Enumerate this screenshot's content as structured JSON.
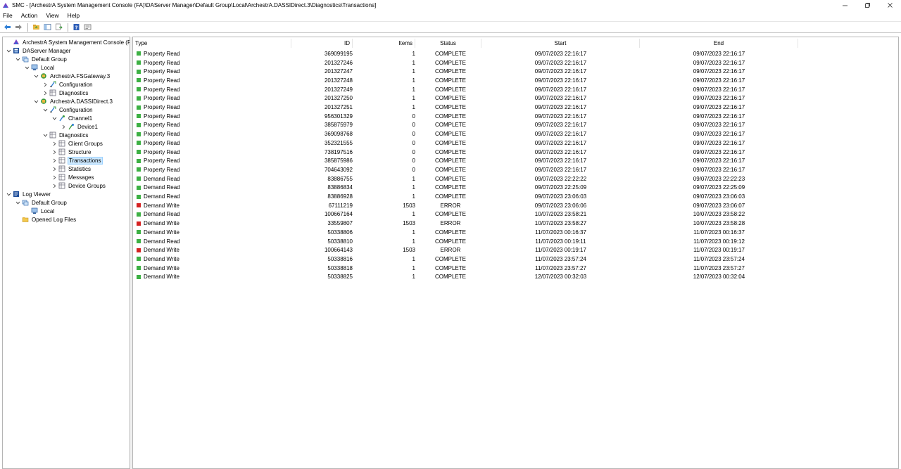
{
  "window": {
    "title": "SMC - [ArchestrA System Management Console (FA)\\DAServer Manager\\Default Group\\Local\\ArchestrA.DASSIDirect.3\\Diagnostics\\Transactions]"
  },
  "menu": [
    "File",
    "Action",
    "View",
    "Help"
  ],
  "colors": {
    "ok": "#3cb043",
    "error": "#d42020",
    "selection": "#cce8ff"
  },
  "tree": [
    {
      "label": "ArchestrA System Management Console (FA)",
      "level": 0,
      "chevron": "none",
      "icon": "console-icon"
    },
    {
      "label": "DAServer Manager",
      "level": 0,
      "chevron": "down",
      "icon": "server-manager-icon"
    },
    {
      "label": "Default Group",
      "level": 1,
      "chevron": "down",
      "icon": "group-icon"
    },
    {
      "label": "Local",
      "level": 2,
      "chevron": "down",
      "icon": "computer-icon"
    },
    {
      "label": "ArchestrA.FSGateway.3",
      "level": 3,
      "chevron": "down",
      "icon": "daserver-icon"
    },
    {
      "label": "Configuration",
      "level": 4,
      "chevron": "right",
      "icon": "configuration-icon"
    },
    {
      "label": "Diagnostics",
      "level": 4,
      "chevron": "right",
      "icon": "diagnostics-icon"
    },
    {
      "label": "ArchestrA.DASSIDirect.3",
      "level": 3,
      "chevron": "down",
      "icon": "daserver-icon"
    },
    {
      "label": "Configuration",
      "level": 4,
      "chevron": "down",
      "icon": "configuration-icon"
    },
    {
      "label": "Channel1",
      "level": 5,
      "chevron": "down",
      "icon": "channel-icon"
    },
    {
      "label": "Device1",
      "level": 6,
      "chevron": "right",
      "icon": "device-icon"
    },
    {
      "label": "Diagnostics",
      "level": 4,
      "chevron": "down",
      "icon": "diagnostics-icon"
    },
    {
      "label": "Client Groups",
      "level": 5,
      "chevron": "right",
      "icon": "diagnostics-icon"
    },
    {
      "label": "Structure",
      "level": 5,
      "chevron": "right",
      "icon": "diagnostics-icon"
    },
    {
      "label": "Transactions",
      "level": 5,
      "chevron": "right",
      "icon": "diagnostics-icon",
      "selected": true
    },
    {
      "label": "Statistics",
      "level": 5,
      "chevron": "right",
      "icon": "diagnostics-icon"
    },
    {
      "label": "Messages",
      "level": 5,
      "chevron": "right",
      "icon": "diagnostics-icon"
    },
    {
      "label": "Device Groups",
      "level": 5,
      "chevron": "right",
      "icon": "diagnostics-icon"
    },
    {
      "label": "Log Viewer",
      "level": 0,
      "chevron": "down",
      "icon": "log-viewer-icon"
    },
    {
      "label": "Default Group",
      "level": 1,
      "chevron": "down",
      "icon": "group-icon"
    },
    {
      "label": "Local",
      "level": 2,
      "chevron": "none",
      "icon": "computer-icon"
    },
    {
      "label": "Opened Log Files",
      "level": 1,
      "chevron": "none",
      "icon": "folder-icon"
    }
  ],
  "list": {
    "columns": {
      "type": "Type",
      "id": "ID",
      "items": "Items",
      "status": "Status",
      "start": "Start",
      "end": "End"
    },
    "rows": [
      {
        "type": "Property Read",
        "id": "369099195",
        "items": "1",
        "status": "COMPLETE",
        "start": "09/07/2023 22:16:17",
        "end": "09/07/2023 22:16:17",
        "state": "ok"
      },
      {
        "type": "Property Read",
        "id": "201327246",
        "items": "1",
        "status": "COMPLETE",
        "start": "09/07/2023 22:16:17",
        "end": "09/07/2023 22:16:17",
        "state": "ok"
      },
      {
        "type": "Property Read",
        "id": "201327247",
        "items": "1",
        "status": "COMPLETE",
        "start": "09/07/2023 22:16:17",
        "end": "09/07/2023 22:16:17",
        "state": "ok"
      },
      {
        "type": "Property Read",
        "id": "201327248",
        "items": "1",
        "status": "COMPLETE",
        "start": "09/07/2023 22:16:17",
        "end": "09/07/2023 22:16:17",
        "state": "ok"
      },
      {
        "type": "Property Read",
        "id": "201327249",
        "items": "1",
        "status": "COMPLETE",
        "start": "09/07/2023 22:16:17",
        "end": "09/07/2023 22:16:17",
        "state": "ok"
      },
      {
        "type": "Property Read",
        "id": "201327250",
        "items": "1",
        "status": "COMPLETE",
        "start": "09/07/2023 22:16:17",
        "end": "09/07/2023 22:16:17",
        "state": "ok"
      },
      {
        "type": "Property Read",
        "id": "201327251",
        "items": "1",
        "status": "COMPLETE",
        "start": "09/07/2023 22:16:17",
        "end": "09/07/2023 22:16:17",
        "state": "ok"
      },
      {
        "type": "Property Read",
        "id": "956301329",
        "items": "0",
        "status": "COMPLETE",
        "start": "09/07/2023 22:16:17",
        "end": "09/07/2023 22:16:17",
        "state": "ok"
      },
      {
        "type": "Property Read",
        "id": "385875979",
        "items": "0",
        "status": "COMPLETE",
        "start": "09/07/2023 22:16:17",
        "end": "09/07/2023 22:16:17",
        "state": "ok"
      },
      {
        "type": "Property Read",
        "id": "369098768",
        "items": "0",
        "status": "COMPLETE",
        "start": "09/07/2023 22:16:17",
        "end": "09/07/2023 22:16:17",
        "state": "ok"
      },
      {
        "type": "Property Read",
        "id": "352321555",
        "items": "0",
        "status": "COMPLETE",
        "start": "09/07/2023 22:16:17",
        "end": "09/07/2023 22:16:17",
        "state": "ok"
      },
      {
        "type": "Property Read",
        "id": "738197516",
        "items": "0",
        "status": "COMPLETE",
        "start": "09/07/2023 22:16:17",
        "end": "09/07/2023 22:16:17",
        "state": "ok"
      },
      {
        "type": "Property Read",
        "id": "385875986",
        "items": "0",
        "status": "COMPLETE",
        "start": "09/07/2023 22:16:17",
        "end": "09/07/2023 22:16:17",
        "state": "ok"
      },
      {
        "type": "Property Read",
        "id": "704643092",
        "items": "0",
        "status": "COMPLETE",
        "start": "09/07/2023 22:16:17",
        "end": "09/07/2023 22:16:17",
        "state": "ok"
      },
      {
        "type": "Demand Read",
        "id": "83886755",
        "items": "1",
        "status": "COMPLETE",
        "start": "09/07/2023 22:22:22",
        "end": "09/07/2023 22:22:23",
        "state": "ok"
      },
      {
        "type": "Demand Read",
        "id": "83886834",
        "items": "1",
        "status": "COMPLETE",
        "start": "09/07/2023 22:25:09",
        "end": "09/07/2023 22:25:09",
        "state": "ok"
      },
      {
        "type": "Demand Read",
        "id": "83886928",
        "items": "1",
        "status": "COMPLETE",
        "start": "09/07/2023 23:06:03",
        "end": "09/07/2023 23:06:03",
        "state": "ok"
      },
      {
        "type": "Demand Write",
        "id": "67111219",
        "items": "1503",
        "status": "ERROR",
        "start": "09/07/2023 23:06:06",
        "end": "09/07/2023 23:06:07",
        "state": "error"
      },
      {
        "type": "Demand Read",
        "id": "100667164",
        "items": "1",
        "status": "COMPLETE",
        "start": "10/07/2023 23:58:21",
        "end": "10/07/2023 23:58:22",
        "state": "ok"
      },
      {
        "type": "Demand Write",
        "id": "33559807",
        "items": "1503",
        "status": "ERROR",
        "start": "10/07/2023 23:58:27",
        "end": "10/07/2023 23:58:28",
        "state": "error"
      },
      {
        "type": "Demand Write",
        "id": "50338806",
        "items": "1",
        "status": "COMPLETE",
        "start": "11/07/2023 00:16:37",
        "end": "11/07/2023 00:16:37",
        "state": "ok"
      },
      {
        "type": "Demand Read",
        "id": "50338810",
        "items": "1",
        "status": "COMPLETE",
        "start": "11/07/2023 00:19:11",
        "end": "11/07/2023 00:19:12",
        "state": "ok"
      },
      {
        "type": "Demand Write",
        "id": "100664143",
        "items": "1503",
        "status": "ERROR",
        "start": "11/07/2023 00:19:17",
        "end": "11/07/2023 00:19:17",
        "state": "error"
      },
      {
        "type": "Demand Write",
        "id": "50338816",
        "items": "1",
        "status": "COMPLETE",
        "start": "11/07/2023 23:57:24",
        "end": "11/07/2023 23:57:24",
        "state": "ok"
      },
      {
        "type": "Demand Write",
        "id": "50338818",
        "items": "1",
        "status": "COMPLETE",
        "start": "11/07/2023 23:57:27",
        "end": "11/07/2023 23:57:27",
        "state": "ok"
      },
      {
        "type": "Demand Write",
        "id": "50338825",
        "items": "1",
        "status": "COMPLETE",
        "start": "12/07/2023 00:32:03",
        "end": "12/07/2023 00:32:04",
        "state": "ok"
      }
    ]
  }
}
